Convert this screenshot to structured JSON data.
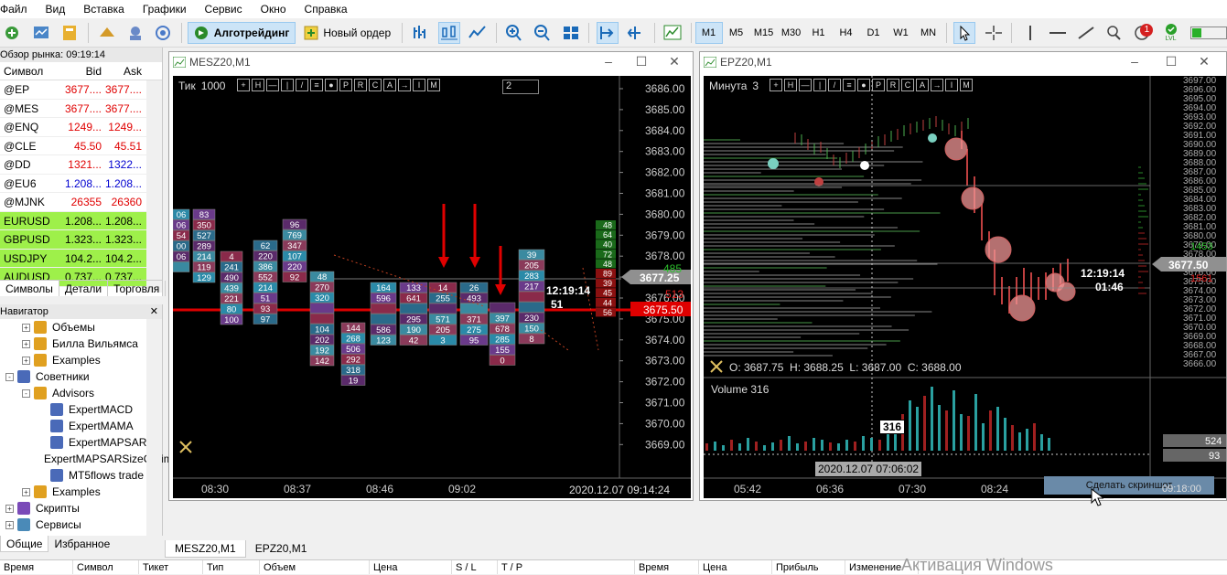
{
  "menu": [
    "Файл",
    "Вид",
    "Вставка",
    "Графики",
    "Сервис",
    "Окно",
    "Справка"
  ],
  "toolbar": {
    "algotrading": "Алготрейдинг",
    "new_order": "Новый ордер",
    "timeframes": [
      "M1",
      "M5",
      "M15",
      "M30",
      "H1",
      "H4",
      "D1",
      "W1",
      "MN"
    ],
    "active_timeframe": "M1",
    "notif_count": "1",
    "lvl_label": "LVL"
  },
  "market_watch": {
    "title": "Обзор рынка: 09:19:14",
    "col_symbol": "Символ",
    "col_bid": "Bid",
    "col_ask": "Ask",
    "rows": [
      {
        "symbol": "@EP",
        "bid": "3677....",
        "ask": "3677....",
        "bid_color": "red",
        "ask_color": "red",
        "green": false
      },
      {
        "symbol": "@MES",
        "bid": "3677....",
        "ask": "3677....",
        "bid_color": "red",
        "ask_color": "red",
        "green": false
      },
      {
        "symbol": "@ENQ",
        "bid": "1249...",
        "ask": "1249...",
        "bid_color": "red",
        "ask_color": "red",
        "green": false
      },
      {
        "symbol": "@CLE",
        "bid": "45.50",
        "ask": "45.51",
        "bid_color": "red",
        "ask_color": "red",
        "green": false
      },
      {
        "symbol": "@DD",
        "bid": "1321...",
        "ask": "1322...",
        "bid_color": "red",
        "ask_color": "blue",
        "green": false
      },
      {
        "symbol": "@EU6",
        "bid": "1.208...",
        "ask": "1.208...",
        "bid_color": "blue",
        "ask_color": "blue",
        "green": false
      },
      {
        "symbol": "@MJNK",
        "bid": "26355",
        "ask": "26360",
        "bid_color": "red",
        "ask_color": "red",
        "green": false
      },
      {
        "symbol": "EURUSD",
        "bid": "1.208...",
        "ask": "1.208...",
        "bid_color": "blue",
        "ask_color": "blue",
        "green": true
      },
      {
        "symbol": "GBPUSD",
        "bid": "1.323...",
        "ask": "1.323...",
        "bid_color": "blue",
        "ask_color": "blue",
        "green": true
      },
      {
        "symbol": "USDJPY",
        "bid": "104.2...",
        "ask": "104.2...",
        "bid_color": "red",
        "ask_color": "blue",
        "green": true
      },
      {
        "symbol": "AUDUSD",
        "bid": "0.737...",
        "ask": "0.737...",
        "bid_color": "blue",
        "ask_color": "blue",
        "green": true
      }
    ],
    "tabs": [
      "Символы",
      "Детали",
      "Торговля"
    ]
  },
  "navigator": {
    "title": "Навигатор",
    "items": [
      {
        "label": "Объемы",
        "level": 1,
        "expander": "+",
        "icon": "folder"
      },
      {
        "label": "Билла Вильямса",
        "level": 1,
        "expander": "+",
        "icon": "folder"
      },
      {
        "label": "Examples",
        "level": 1,
        "expander": "+",
        "icon": "folder"
      },
      {
        "label": "Советники",
        "level": 0,
        "expander": "-",
        "icon": "experts"
      },
      {
        "label": "Advisors",
        "level": 1,
        "expander": "-",
        "icon": "folder"
      },
      {
        "label": "ExpertMACD",
        "level": 2,
        "expander": "",
        "icon": "expert"
      },
      {
        "label": "ExpertMAMA",
        "level": 2,
        "expander": "",
        "icon": "expert"
      },
      {
        "label": "ExpertMAPSAR",
        "level": 2,
        "expander": "",
        "icon": "expert"
      },
      {
        "label": "ExpertMAPSARSizeOptimized",
        "level": 2,
        "expander": "",
        "icon": "expert"
      },
      {
        "label": "MT5flows trade",
        "level": 2,
        "expander": "",
        "icon": "expert"
      },
      {
        "label": "Examples",
        "level": 1,
        "expander": "+",
        "icon": "folder"
      },
      {
        "label": "Скрипты",
        "level": 0,
        "expander": "+",
        "icon": "scripts"
      },
      {
        "label": "Сервисы",
        "level": 0,
        "expander": "+",
        "icon": "services"
      }
    ],
    "tabs": [
      "Общие",
      "Избранное"
    ]
  },
  "chart1": {
    "title": "MESZ20,M1",
    "label_mode": "Тик",
    "label_value": "1000",
    "spinner_value": "2",
    "price_labels": [
      "3686.00",
      "3685.00",
      "3684.00",
      "3683.00",
      "3682.00",
      "3681.00",
      "3680.00",
      "3679.00",
      "3678.00",
      "3677.00",
      "3676.00",
      "3675.00",
      "3674.00",
      "3673.00",
      "3672.00",
      "3671.00",
      "3670.00",
      "3669.00"
    ],
    "current_price": "3677.25",
    "red_price": "3675.50",
    "time_labels": [
      "08:30",
      "08:37",
      "08:46",
      "09:02"
    ],
    "datetime": "2020.12.07 09:14:24",
    "timer": "12:19:14",
    "timer_sub": "51",
    "side_volumes": [
      {
        "v": "48",
        "c": "g"
      },
      {
        "v": "64",
        "c": "g"
      },
      {
        "v": "40",
        "c": "g"
      },
      {
        "v": "72",
        "c": "g"
      },
      {
        "v": "48",
        "c": "g"
      },
      {
        "v": "89",
        "c": "r"
      },
      {
        "v": "39",
        "c": "r"
      },
      {
        "v": "45",
        "c": "r"
      },
      {
        "v": "44",
        "c": "r"
      },
      {
        "v": "56",
        "c": "r"
      }
    ],
    "vol_green": "485",
    "vol_red": "513"
  },
  "chart2": {
    "title": "EPZ20,M1",
    "label_mode": "Минута",
    "label_value": "3",
    "price_labels": [
      "3697.00",
      "3696.00",
      "3695.00",
      "3694.00",
      "3693.00",
      "3692.00",
      "3691.00",
      "3690.00",
      "3689.00",
      "3688.00",
      "3687.00",
      "3686.00",
      "3685.00",
      "3684.00",
      "3683.00",
      "3682.00",
      "3681.00",
      "3680.00",
      "3679.00",
      "3678.00",
      "3677.00",
      "3676.00",
      "3675.00",
      "3674.00",
      "3673.00",
      "3672.00",
      "3671.00",
      "3670.00",
      "3669.00",
      "3668.00",
      "3667.00",
      "3666.00"
    ],
    "current_price": "3677.50",
    "vol_green": "1453",
    "vol_red": "1561",
    "timer": "12:19:14",
    "timer_sub": "01:46",
    "ohlc": "O: 3687.75  H: 3688.25  L: 3687.00  C: 3688.00",
    "volume_label": "Volume 316",
    "volume_tip": "316",
    "vol_axis_1": "524",
    "vol_axis_2": "93",
    "time_labels": [
      "05:42",
      "06:36",
      "07:30",
      "08:24"
    ],
    "crosshair_time": "2020.12.07 07:06:02",
    "screenshot_btn": "Сделать скриншот",
    "time_right": "09:18:00"
  },
  "chart_tabs": [
    "MESZ20,M1",
    "EPZ20,M1"
  ],
  "terminal_headers": [
    "Время",
    "Символ",
    "Тикет",
    "Тип",
    "Объем",
    "Цена",
    "S / L",
    "T / P",
    "Время",
    "Цена",
    "Прибыль",
    "Изменение"
  ],
  "watermark": "Активация Windows"
}
